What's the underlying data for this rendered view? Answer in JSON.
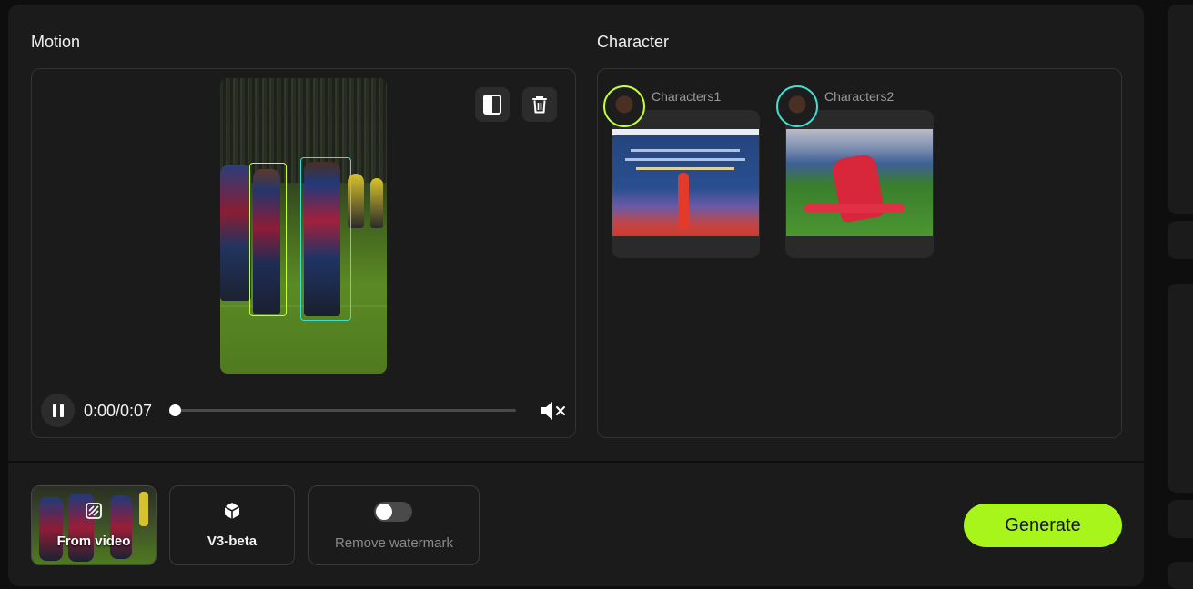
{
  "motion": {
    "title": "Motion",
    "time": "0:00/0:07",
    "progress": 0
  },
  "character": {
    "title": "Character",
    "items": [
      {
        "label": "Characters1",
        "ring_color": "#c6ff3a"
      },
      {
        "label": "Characters2",
        "ring_color": "#40e0d0"
      }
    ]
  },
  "bottom": {
    "from_video_label": "From video",
    "model_label": "V3-beta",
    "remove_watermark_label": "Remove watermark",
    "remove_watermark_on": false,
    "generate_label": "Generate"
  },
  "colors": {
    "accent": "#a8f51c",
    "panel": "#1b1b1b",
    "background": "#0e0e0e",
    "selection_1": "#c6ff3a",
    "selection_2": "#40e0d0"
  },
  "icons": {
    "split_view": "split-view-icon",
    "delete": "trash-icon",
    "pause": "pause-icon",
    "mute": "mute-icon",
    "from_video": "video-stripes-icon",
    "model": "cube-icon"
  }
}
